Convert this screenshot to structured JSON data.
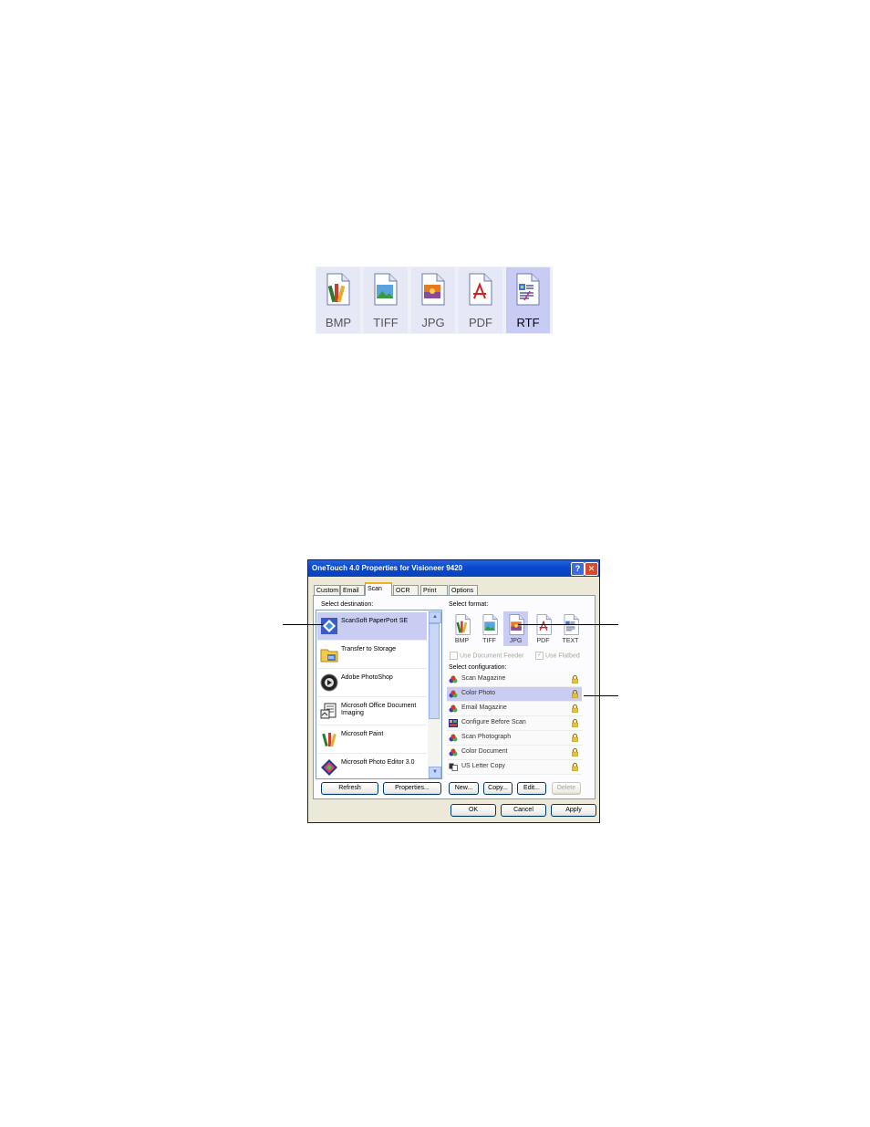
{
  "format_strip": {
    "items": [
      {
        "label": "BMP",
        "icon": "bmp-file-icon",
        "selected": false
      },
      {
        "label": "TIFF",
        "icon": "tiff-file-icon",
        "selected": false
      },
      {
        "label": "JPG",
        "icon": "jpg-file-icon",
        "selected": false
      },
      {
        "label": "PDF",
        "icon": "pdf-file-icon",
        "selected": false
      },
      {
        "label": "RTF",
        "icon": "rtf-file-icon",
        "selected": true
      }
    ]
  },
  "dialog": {
    "title": "OneTouch 4.0 Properties for Visioneer 9420",
    "help_glyph": "?",
    "close_glyph": "✕",
    "tabs": [
      {
        "label": "Custom"
      },
      {
        "label": "Email"
      },
      {
        "label": "Scan",
        "active": true
      },
      {
        "label": "OCR"
      },
      {
        "label": "Print"
      },
      {
        "label": "Options"
      }
    ],
    "select_destination_label": "Select destination:",
    "destinations": [
      {
        "label": "ScanSoft PaperPort SE",
        "icon": "paperport-icon",
        "selected": true
      },
      {
        "label": "Transfer to Storage",
        "icon": "folder-storage-icon"
      },
      {
        "label": "Adobe PhotoShop",
        "icon": "photoshop-icon"
      },
      {
        "label": "Microsoft Office Document Imaging",
        "icon": "office-imaging-icon"
      },
      {
        "label": "Microsoft Paint",
        "icon": "paint-icon"
      },
      {
        "label": "Microsoft Photo Editor 3.0",
        "icon": "photo-editor-icon"
      }
    ],
    "refresh_label": "Refresh",
    "properties_label": "Properties...",
    "select_format_label": "Select format:",
    "formats": [
      {
        "label": "BMP"
      },
      {
        "label": "TIFF"
      },
      {
        "label": "JPG",
        "selected": true
      },
      {
        "label": "PDF"
      },
      {
        "label": "TEXT"
      }
    ],
    "use_document_feeder_label": "Use Document Feeder",
    "use_flatbed_label": "Use Flatbed",
    "use_flatbed_checked": true,
    "select_configuration_label": "Select configuration:",
    "configurations": [
      {
        "label": "Scan Magazine"
      },
      {
        "label": "Color Photo",
        "selected": true
      },
      {
        "label": "Email Magazine"
      },
      {
        "label": "Configure Before Scan"
      },
      {
        "label": "Scan Photograph"
      },
      {
        "label": "Color Document"
      },
      {
        "label": "US Letter Copy"
      }
    ],
    "new_label": "New...",
    "copy_label": "Copy...",
    "edit_label": "Edit...",
    "delete_label": "Delete",
    "ok_label": "OK",
    "cancel_label": "Cancel",
    "apply_label": "Apply"
  }
}
